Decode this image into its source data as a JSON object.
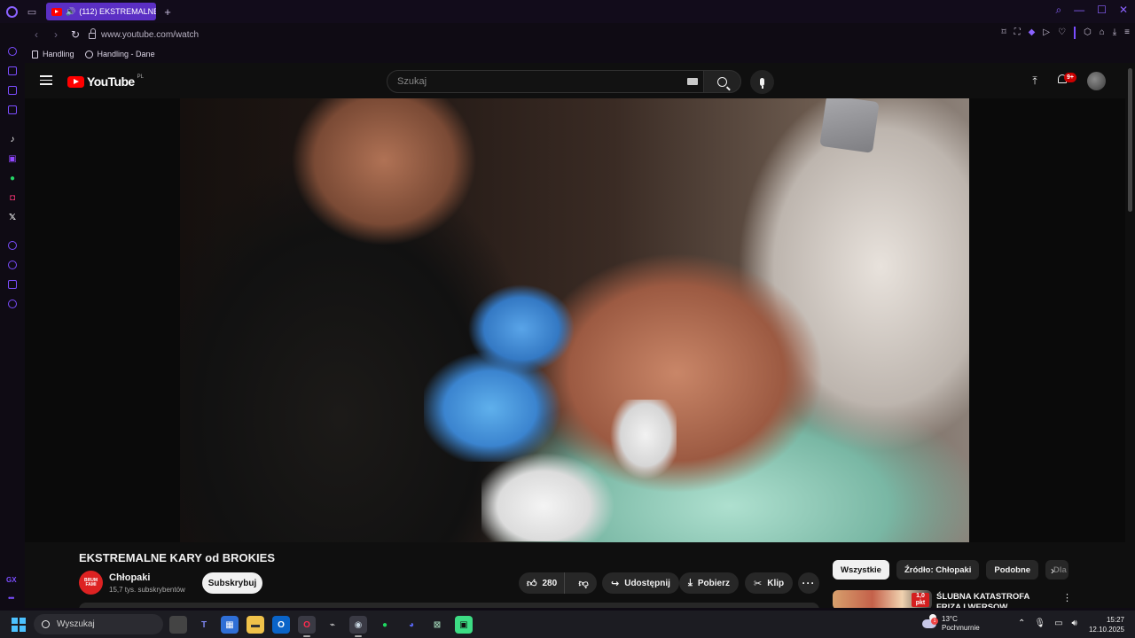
{
  "browser": {
    "tab_title": "(112) EKSTREMALNE K",
    "url": "www.youtube.com/watch",
    "bookmarks": [
      "Handling",
      "Handling - Dane"
    ],
    "accent": "#7b4dff",
    "sidebar_icons": [
      "aria-icon",
      "ai-icon",
      "messenger-icon",
      "notes-icon",
      "tiktok-icon",
      "twitch-icon",
      "whatsapp-icon",
      "instagram-icon",
      "x-icon",
      "player-icon",
      "history-icon",
      "extensions-icon",
      "settings-icon"
    ],
    "sidebar_gx_label": "GX"
  },
  "youtube": {
    "logo_word": "YouTube",
    "logo_country": "PL",
    "search_placeholder": "Szukaj",
    "notifications": "9+",
    "video": {
      "title": "EKSTREMALNE KARY od BROKIES",
      "channel": "Chłopaki",
      "subscribers": "15,7 tys. subskrybentów",
      "subscribe_label": "Subskrybuj",
      "likes": "280",
      "share_label": "Udostępnij",
      "download_label": "Pobierz",
      "clip_label": "Klip",
      "more_label": "···",
      "channel_avatar_text": "BRUM FAMI"
    },
    "chips": [
      "Wszystkie",
      "Źródło: Chłopaki",
      "Podobne",
      "Dla"
    ],
    "recommended": {
      "title": "ŚLUBNA KATASTROFA FRIZA I WERSOW",
      "badge": "1,0 pkt"
    }
  },
  "taskbar": {
    "search_label": "Wyszukaj",
    "apps": [
      "taskview",
      "teams",
      "store",
      "explorer",
      "outlook",
      "opera-gx",
      "kali",
      "steam",
      "spotify",
      "discord",
      "xbox",
      "android"
    ],
    "weather_temp": "13°C",
    "weather_desc": "Pochmurnie",
    "weather_badge": "1",
    "time": "15:27",
    "date": "12.10.2025"
  }
}
